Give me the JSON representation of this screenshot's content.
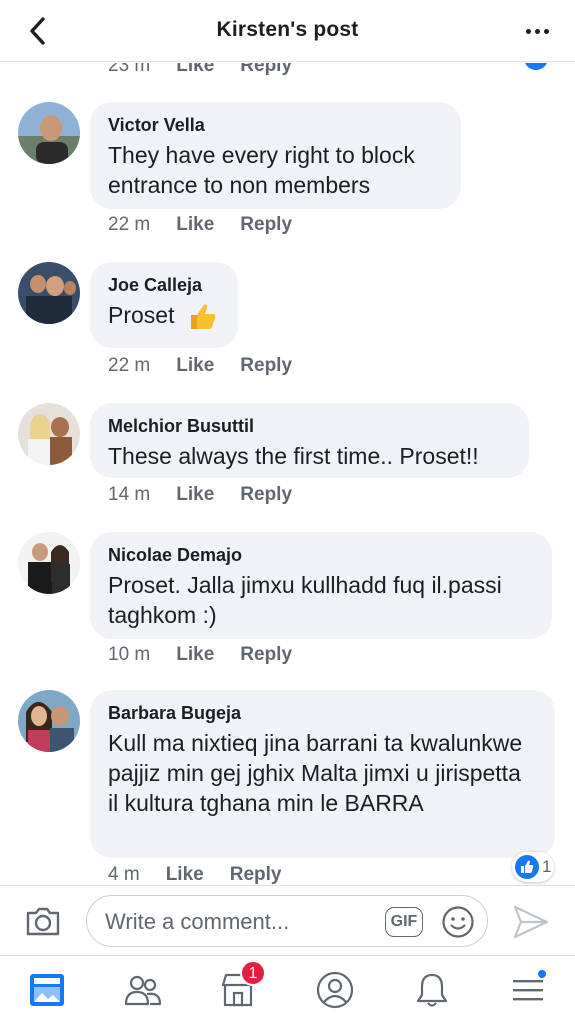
{
  "header": {
    "title": "Kirsten's post",
    "back_icon": "chevron-left-icon",
    "more_icon": "more-dots-icon"
  },
  "partial": {
    "time": "23 m",
    "like": "Like",
    "reply": "Reply"
  },
  "comments": [
    {
      "name": "Victor Vella",
      "text": "They have every right to block entrance to non members",
      "time": "22 m",
      "like": "Like",
      "reply": "Reply"
    },
    {
      "name": "Joe Calleja",
      "text": "Proset",
      "time": "22 m",
      "like": "Like",
      "reply": "Reply"
    },
    {
      "name": "Melchior Busuttil",
      "text": "These always the first time.. Proset!!",
      "time": "14 m",
      "like": "Like",
      "reply": "Reply"
    },
    {
      "name": "Nicolae Demajo",
      "text": "Proset. Jalla jimxu kullhadd fuq il.passi taghkom :)",
      "time": "10 m",
      "like": "Like",
      "reply": "Reply"
    },
    {
      "name": "Barbara Bugeja",
      "text": "Kull ma nixtieq jina barrani ta kwalunkwe pajjiz min gej jghix Malta jimxi u jirispetta il kultura tghana min le BARRA",
      "time": "4 m",
      "like": "Like",
      "reply": "Reply",
      "reaction_count": "1"
    }
  ],
  "composer": {
    "placeholder": "Write a comment...",
    "gif_label": "GIF",
    "camera_icon": "camera-icon",
    "emoji_icon": "emoji-icon",
    "send_icon": "send-icon"
  },
  "tabbar": {
    "marketplace_badge": "1",
    "tabs": [
      "news-feed-icon",
      "groups-icon",
      "marketplace-icon",
      "profile-icon",
      "notifications-icon",
      "menu-icon"
    ]
  },
  "colors": {
    "accent": "#1877f2",
    "bubble": "#f0f2f5",
    "badge": "#e41e3f"
  }
}
